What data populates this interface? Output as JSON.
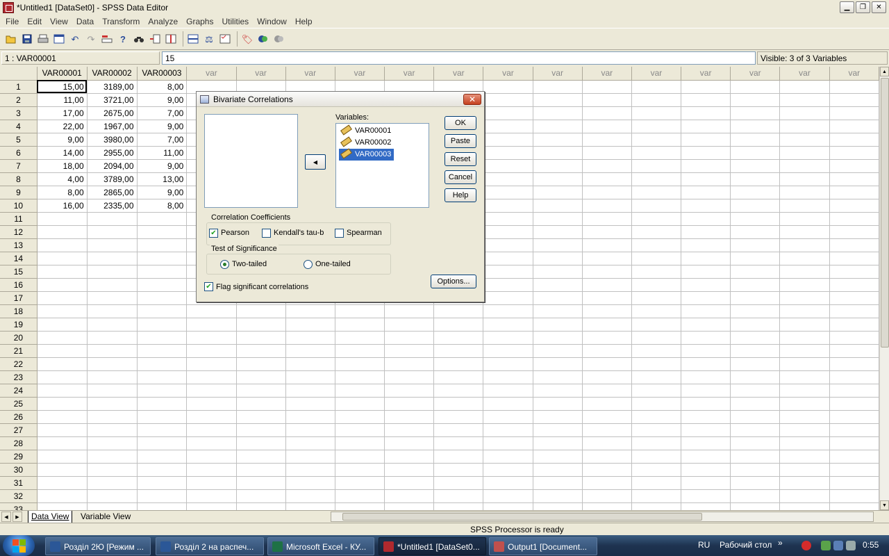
{
  "window": {
    "title": "*Untitled1 [DataSet0] - SPSS Data Editor",
    "minimize": "▁",
    "maximize": "❐",
    "close": "✕"
  },
  "menu": [
    "File",
    "Edit",
    "View",
    "Data",
    "Transform",
    "Analyze",
    "Graphs",
    "Utilities",
    "Window",
    "Help"
  ],
  "toolbar_icons": [
    "open-icon",
    "save-icon",
    "print-icon",
    "dialog-recall-icon",
    "undo-icon",
    "redo-icon",
    "goto-case-icon",
    "variables-icon",
    "find-icon",
    "insert-cases-icon",
    "insert-variable-icon",
    "split-file-icon",
    "weight-cases-icon",
    "select-cases-icon",
    "value-labels-icon",
    "use-sets-icon",
    "show-all-icon"
  ],
  "cellbar": {
    "cell_ref": "1 : VAR00001",
    "cell_value": "15",
    "visible": "Visible: 3 of 3 Variables"
  },
  "grid": {
    "columns": [
      "VAR00001",
      "VAR00002",
      "VAR00003",
      "var",
      "var",
      "var",
      "var",
      "var",
      "var",
      "var",
      "var",
      "var",
      "var",
      "var",
      "var",
      "var",
      "var"
    ],
    "rows": [
      [
        "15,00",
        "3189,00",
        "8,00"
      ],
      [
        "11,00",
        "3721,00",
        "9,00"
      ],
      [
        "17,00",
        "2675,00",
        "7,00"
      ],
      [
        "22,00",
        "1967,00",
        "9,00"
      ],
      [
        "9,00",
        "3980,00",
        "7,00"
      ],
      [
        "14,00",
        "2955,00",
        "11,00"
      ],
      [
        "18,00",
        "2094,00",
        "9,00"
      ],
      [
        "4,00",
        "3789,00",
        "13,00"
      ],
      [
        "8,00",
        "2865,00",
        "9,00"
      ],
      [
        "16,00",
        "2335,00",
        "8,00"
      ]
    ],
    "row_count": 33
  },
  "tabs": {
    "data_view": "Data View",
    "variable_view": "Variable View"
  },
  "status": "SPSS Processor is ready",
  "dialog": {
    "title": "Bivariate Correlations",
    "variables_label": "Variables:",
    "variables": [
      "VAR00001",
      "VAR00002",
      "VAR00003"
    ],
    "selected_variable": "VAR00003",
    "buttons": {
      "ok": "OK",
      "paste": "Paste",
      "reset": "Reset",
      "cancel": "Cancel",
      "help": "Help",
      "options": "Options..."
    },
    "coefficients_label": "Correlation Coefficients",
    "pearson": "Pearson",
    "kendall": "Kendall's tau-b",
    "spearman": "Spearman",
    "significance_label": "Test of Significance",
    "two_tailed": "Two-tailed",
    "one_tailed": "One-tailed",
    "flag": "Flag significant correlations",
    "state": {
      "pearson": true,
      "kendall": false,
      "spearman": false,
      "two_tailed": true,
      "flag": true
    }
  },
  "taskbar": {
    "tasks": [
      "Розділ 2Ю [Режим ...",
      "Розділ 2 на распеч...",
      "Microsoft Excel - КУ...",
      "*Untitled1 [DataSet0...",
      "Output1 [Document..."
    ],
    "active_task": 3,
    "lang": "RU",
    "desktop": "Рабочий стол",
    "clock": "0:55"
  }
}
